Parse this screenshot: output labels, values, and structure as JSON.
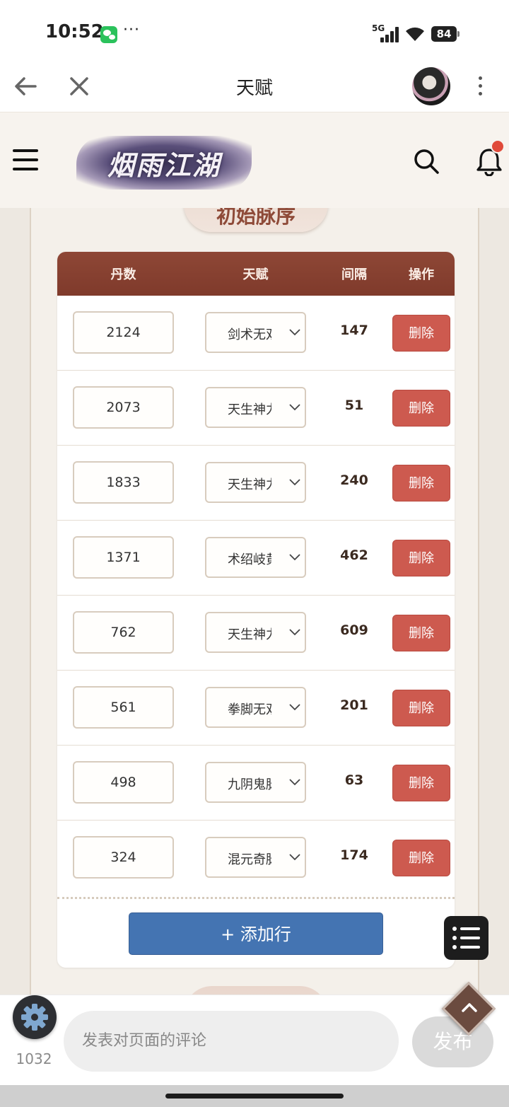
{
  "status_bar": {
    "time": "10:52",
    "dots": "···",
    "network": "5G",
    "battery": "84"
  },
  "topnav": {
    "title": "天赋"
  },
  "site": {
    "logo_text": "烟雨江湖"
  },
  "section": {
    "title": "初始脉序"
  },
  "table": {
    "headers": {
      "pills": "丹数",
      "talent": "天赋",
      "interval": "间隔",
      "action": "操作"
    },
    "rows": [
      {
        "pills": "2124",
        "talent": "剑术无双",
        "interval": "147",
        "action": "删除"
      },
      {
        "pills": "2073",
        "talent": "天生神力",
        "interval": "51",
        "action": "删除"
      },
      {
        "pills": "1833",
        "talent": "天生神力",
        "interval": "240",
        "action": "删除"
      },
      {
        "pills": "1371",
        "talent": "术绍岐黄",
        "interval": "462",
        "action": "删除"
      },
      {
        "pills": "762",
        "talent": "天生神力",
        "interval": "609",
        "action": "删除"
      },
      {
        "pills": "561",
        "talent": "拳脚无双",
        "interval": "201",
        "action": "删除"
      },
      {
        "pills": "498",
        "talent": "九阴鬼脉",
        "interval": "63",
        "action": "删除"
      },
      {
        "pills": "324",
        "talent": "混元奇脉",
        "interval": "174",
        "action": "删除"
      }
    ],
    "add_row_label": "+ 添加行"
  },
  "comment_bar": {
    "count": "1032",
    "placeholder": "发表对页面的评论",
    "publish_label": "发布"
  },
  "colors": {
    "header_brown": "#8e4736",
    "delete_red": "#cd5a4f",
    "add_blue": "#4474b2",
    "notification_dot": "#e04a3a"
  },
  "icons": {
    "back": "arrow-left-icon",
    "close": "close-icon",
    "more": "more-vertical-icon",
    "menu": "hamburger-icon",
    "search": "search-icon",
    "notifications": "bell-icon",
    "list": "list-icon",
    "settings": "gear-icon",
    "scroll_top": "chevron-up-icon"
  }
}
